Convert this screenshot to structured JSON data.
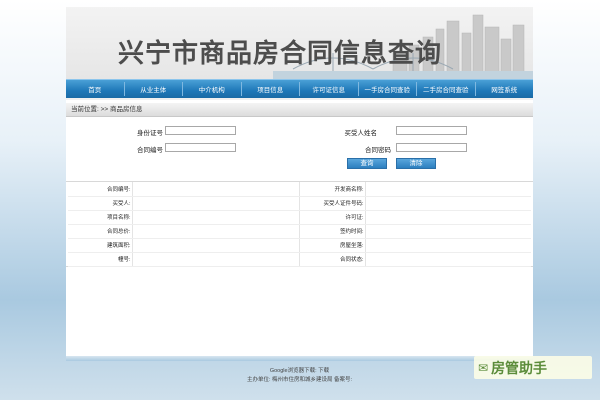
{
  "banner": {
    "title": "兴宁市商品房合同信息查询"
  },
  "nav": {
    "items": [
      "首页",
      "从业主体",
      "中介机构",
      "项目信息",
      "许可证信息",
      "一手房合同查验",
      "二手房合同查验",
      "网签系统"
    ]
  },
  "breadcrumb": {
    "text": "当前位置: >> 商品房信息"
  },
  "search": {
    "id_label": "身份证号",
    "buyer_label": "买受人姓名",
    "contract_no_label": "合同编号",
    "contract_pwd_label": "合同密码",
    "id_value": "",
    "buyer_value": "",
    "contract_no_value": "",
    "contract_pwd_value": "",
    "query_button": "查询",
    "clear_button": "清除"
  },
  "detail": {
    "rows": [
      {
        "l1": "合同编号:",
        "v1": "",
        "l2": "开发商名称:",
        "v2": ""
      },
      {
        "l1": "买受人:",
        "v1": "",
        "l2": "买受人证件号码:",
        "v2": ""
      },
      {
        "l1": "项目名称:",
        "v1": "",
        "l2": "许可证:",
        "v2": ""
      },
      {
        "l1": "合同总价:",
        "v1": "",
        "l2": "签约时间:",
        "v2": ""
      },
      {
        "l1": "建筑面积:",
        "v1": "",
        "l2": "房屋坐落:",
        "v2": ""
      },
      {
        "l1": "幢号:",
        "v1": "",
        "l2": "合同状态:",
        "v2": ""
      }
    ]
  },
  "footer": {
    "line1": "Google浏览器下载: 下载",
    "line2": "主办单位: 梅州市住房和城乡建设局    备案号:"
  },
  "watermark": {
    "text": "房管助手",
    "icon": "chat-bubble-icon"
  },
  "colors": {
    "nav_blue": "#1f78b8",
    "button_blue": "#2d7fbf"
  }
}
